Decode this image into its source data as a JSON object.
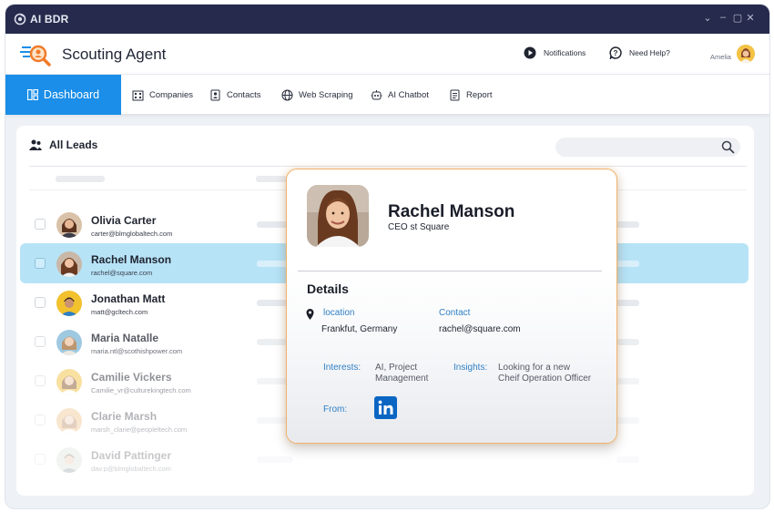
{
  "app": {
    "title": "AI BDR",
    "window_controls": [
      "⌄",
      "–",
      "▢",
      "✕"
    ]
  },
  "header": {
    "title": "Scouting Agent",
    "notifications_label": "Notifications",
    "help_label": "Need Help?",
    "user_name": "Amelia"
  },
  "nav": {
    "items": [
      {
        "label": "Dashboard",
        "icon": "dashboard-icon",
        "active": true
      },
      {
        "label": "Companies",
        "icon": "building-icon"
      },
      {
        "label": "Contacts",
        "icon": "contact-card-icon"
      },
      {
        "label": "Web Scraping",
        "icon": "globe-icon"
      },
      {
        "label": "AI Chatbot",
        "icon": "bot-icon"
      },
      {
        "label": "Report",
        "icon": "report-icon"
      }
    ]
  },
  "leads": {
    "title": "All Leads",
    "rows": [
      {
        "name": "Olivia Carter",
        "email": "carter@blmglobaltech.com"
      },
      {
        "name": "Rachel Manson",
        "email": "rachel@square.com",
        "selected": true
      },
      {
        "name": "Jonathan Matt",
        "email": "matt@gcltech.com"
      },
      {
        "name": "Maria Natalle",
        "email": "maria.ntl@scothishpower.com"
      },
      {
        "name": "Camilie Vickers",
        "email": "Camilie_vr@culturekingtech.com"
      },
      {
        "name": "Clarie Marsh",
        "email": "marsh_clarie@peopleltech.com"
      },
      {
        "name": "David Pattinger",
        "email": "dav.p@blmglobaltech.com"
      }
    ]
  },
  "profile": {
    "name": "Rachel Manson",
    "role": "CEO st Square",
    "details_heading": "Details",
    "location_label": "location",
    "location_value": "Frankfut, Germany",
    "contact_label": "Contact",
    "contact_value": "rachel@square.com",
    "interests_label": "Interests:",
    "interests_value": [
      "AI, Project",
      "Management"
    ],
    "insights_label": "Insights:",
    "insights_value": [
      "Looking for a new",
      "Cheif Operation Officer"
    ],
    "from_label": "From:",
    "source_icon": "linkedin-icon"
  },
  "colors": {
    "accent": "#1a8ee8",
    "titlebar": "#262a4c",
    "selected_row": "#b7e3f7",
    "card_border": "#f1b26a",
    "label_blue": "#2f7fc4"
  }
}
